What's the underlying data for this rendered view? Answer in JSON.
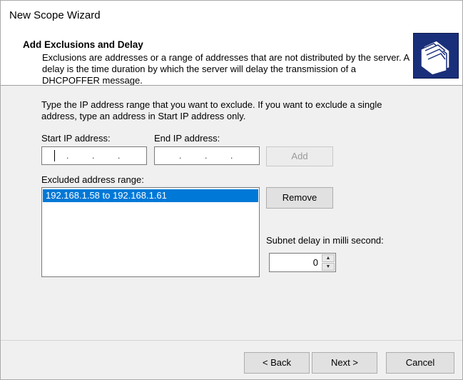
{
  "window": {
    "title": "New Scope Wizard"
  },
  "header": {
    "title": "Add Exclusions and Delay",
    "description": "Exclusions are addresses or a range of addresses that are not distributed by the server. A delay is the time duration by which the server will delay the transmission of a DHCPOFFER message.",
    "icon": "folders-icon"
  },
  "intro": "Type the IP address range that you want to exclude. If you want to exclude a single address, type an address in Start IP address only.",
  "start_ip": {
    "label": "Start IP address:",
    "value": ""
  },
  "end_ip": {
    "label": "End IP address:",
    "value": ""
  },
  "add_label": "Add",
  "excluded": {
    "label": "Excluded address range:",
    "items": [
      "192.168.1.58 to 192.168.1.61"
    ]
  },
  "remove_label": "Remove",
  "delay": {
    "label": "Subnet delay in milli second:",
    "value": "0"
  },
  "footer": {
    "back": "< Back",
    "next": "Next >",
    "cancel": "Cancel"
  },
  "colors": {
    "selection": "#0078d7",
    "header_icon_bg": "#1a2f7a"
  }
}
